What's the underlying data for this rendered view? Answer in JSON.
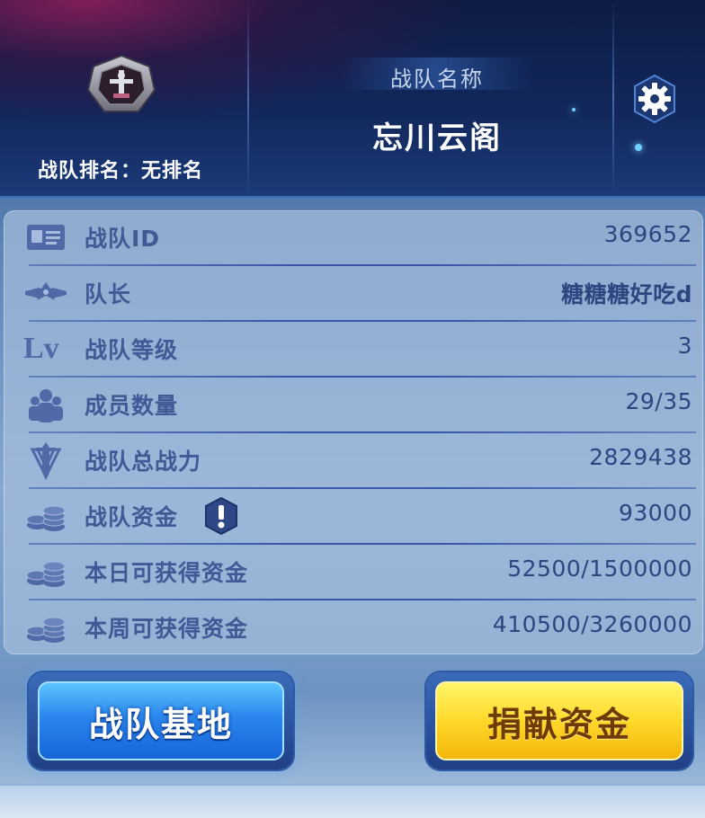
{
  "header": {
    "rank_label": "战队排名：无排名",
    "name_label": "战队名称",
    "team_name": "忘川云阁"
  },
  "info_rows": [
    {
      "icon": "id-card-icon",
      "label": "战队ID",
      "value": "369652"
    },
    {
      "icon": "captain-wings-icon",
      "label": "队长",
      "value": "糖糖糖好吃d"
    },
    {
      "icon": "level-icon",
      "label": "战队等级",
      "value": "3",
      "icon_text": "Lv"
    },
    {
      "icon": "members-icon",
      "label": "成员数量",
      "value": "29/35"
    },
    {
      "icon": "sword-power-icon",
      "label": "战队总战力",
      "value": "2829438"
    },
    {
      "icon": "coins-icon",
      "label": "战队资金",
      "value": "93000"
    },
    {
      "icon": "coins-icon",
      "label": "本日可获得资金",
      "value": "52500/1500000"
    },
    {
      "icon": "coins-icon",
      "label": "本周可获得资金",
      "value": "410500/3260000"
    }
  ],
  "buttons": {
    "base": "战队基地",
    "donate": "捐献资金"
  },
  "colors": {
    "label": "#3f5a95",
    "value": "#2e4680",
    "accent_blue": "#2a86ee",
    "accent_yellow": "#ffd92a"
  }
}
